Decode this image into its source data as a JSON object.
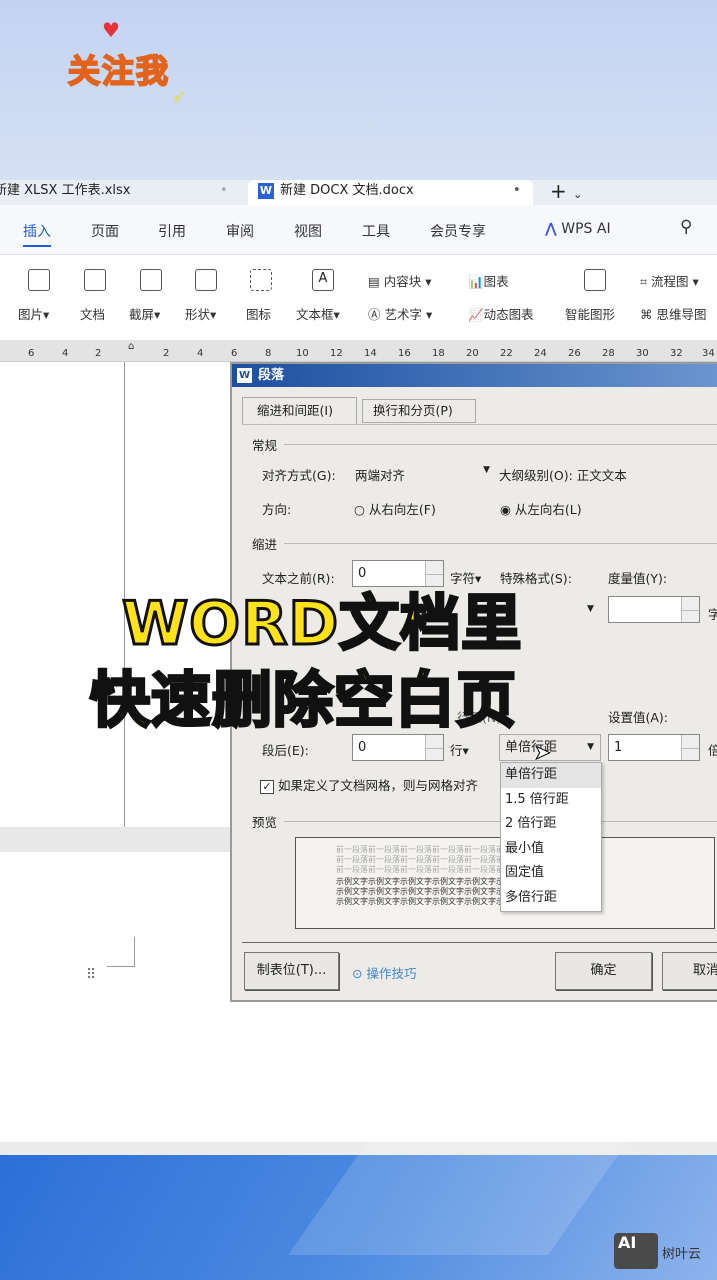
{
  "sticker": {
    "text": "关注我"
  },
  "tabs": [
    {
      "label": "新建 XLSX 工作表.xlsx"
    },
    {
      "label": "新建 DOCX 文档.docx"
    }
  ],
  "menu": [
    "插入",
    "页面",
    "引用",
    "审阅",
    "视图",
    "工具",
    "会员专享",
    "WPS AI"
  ],
  "ribbon": {
    "top": [
      "内容块",
      "图表",
      "流程图"
    ],
    "bottom": [
      "图片",
      "文档",
      "截屏",
      "形状",
      "图标",
      "文本框",
      "艺术字",
      "动态图表",
      "智能图形",
      "思维导图"
    ]
  },
  "ruler": [
    "6",
    "4",
    "2",
    "2",
    "4",
    "6",
    "8",
    "10",
    "12",
    "14",
    "16",
    "18",
    "20",
    "22",
    "24",
    "26",
    "28",
    "30",
    "32",
    "34"
  ],
  "dialog": {
    "title": "段落",
    "tabs": [
      "缩进和间距(I)",
      "换行和分页(P)"
    ],
    "general": "常规",
    "align_label": "对齐方式(G):",
    "align_value": "两端对齐",
    "outline_label": "大纲级别(O):",
    "outline_value": "正文文本",
    "direction_label": "方向:",
    "rtl": "从右向左(F)",
    "ltr": "从左向右(L)",
    "indent": "缩进",
    "before_text_label": "文本之前(R):",
    "before_text_value": "0",
    "unit_char": "字符",
    "special_label": "特殊格式(S):",
    "measure_label": "度量值(Y):",
    "unit_zi": "字",
    "line_spacing_label": "行距(N):",
    "set_value_label": "设置值(A):",
    "after_label": "段后(E):",
    "after_value": "0",
    "unit_line": "行",
    "spacing_value": "单倍行距",
    "set_value": "1",
    "unit_bei": "倍",
    "grid_checkbox": "如果定义了文档网格，则与网格对齐",
    "preview_label": "预览",
    "preview_prev": "前一段落前一段落前一段落前一段落前一段落前一段落前一段落",
    "preview_sample": "示例文字示例文字示例文字示例文字示例文字示例文字示例文字示例文字",
    "tabstop_button": "制表位(T)...",
    "tips_link": "操作技巧",
    "ok_button": "确定",
    "cancel_button": "取消"
  },
  "dropdown_options": [
    "单倍行距",
    "1.5 倍行距",
    "2 倍行距",
    "最小值",
    "固定值",
    "多倍行距"
  ],
  "overlay": {
    "line1": "WORD文档里",
    "line2": "快速删除空白页"
  },
  "watermark": {
    "text": "树叶云",
    "logo": "AI"
  },
  "colors": {
    "yellow": "#ffe21a",
    "accent": "#2b6fd8",
    "link": "#3d86d6"
  }
}
